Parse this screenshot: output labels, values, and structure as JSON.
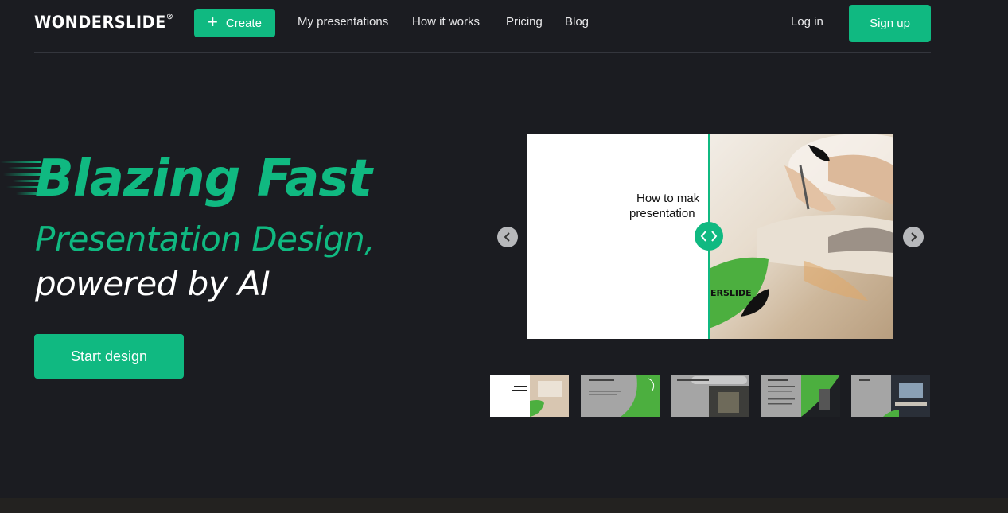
{
  "nav": {
    "logo": "WONDERSLIDE",
    "logo_mark": "®",
    "create_label": "Create",
    "links": [
      "My presentations",
      "How it works",
      "Pricing",
      "Blog"
    ],
    "login_label": "Log in",
    "signup_label": "Sign up"
  },
  "hero": {
    "headline_line1": "Blazing Fast",
    "headline_line2": "Presentation Design,",
    "headline_line3": "powered by AI",
    "cta_label": "Start design"
  },
  "slider": {
    "slide_title_line1": "How to mak",
    "slide_title_line2": "presentation",
    "slide_brand": "ERSLIDE",
    "thumbnails": [
      {
        "text": "How to make presentation"
      },
      {
        "text": "What you need to"
      },
      {
        "text": "Welcome to Wonderslide"
      },
      {
        "text": "Select properties"
      },
      {
        "text": "Result"
      }
    ]
  },
  "colors": {
    "accent": "#10b981",
    "background": "#1b1c21",
    "leaf_green": "#4caf3f"
  }
}
